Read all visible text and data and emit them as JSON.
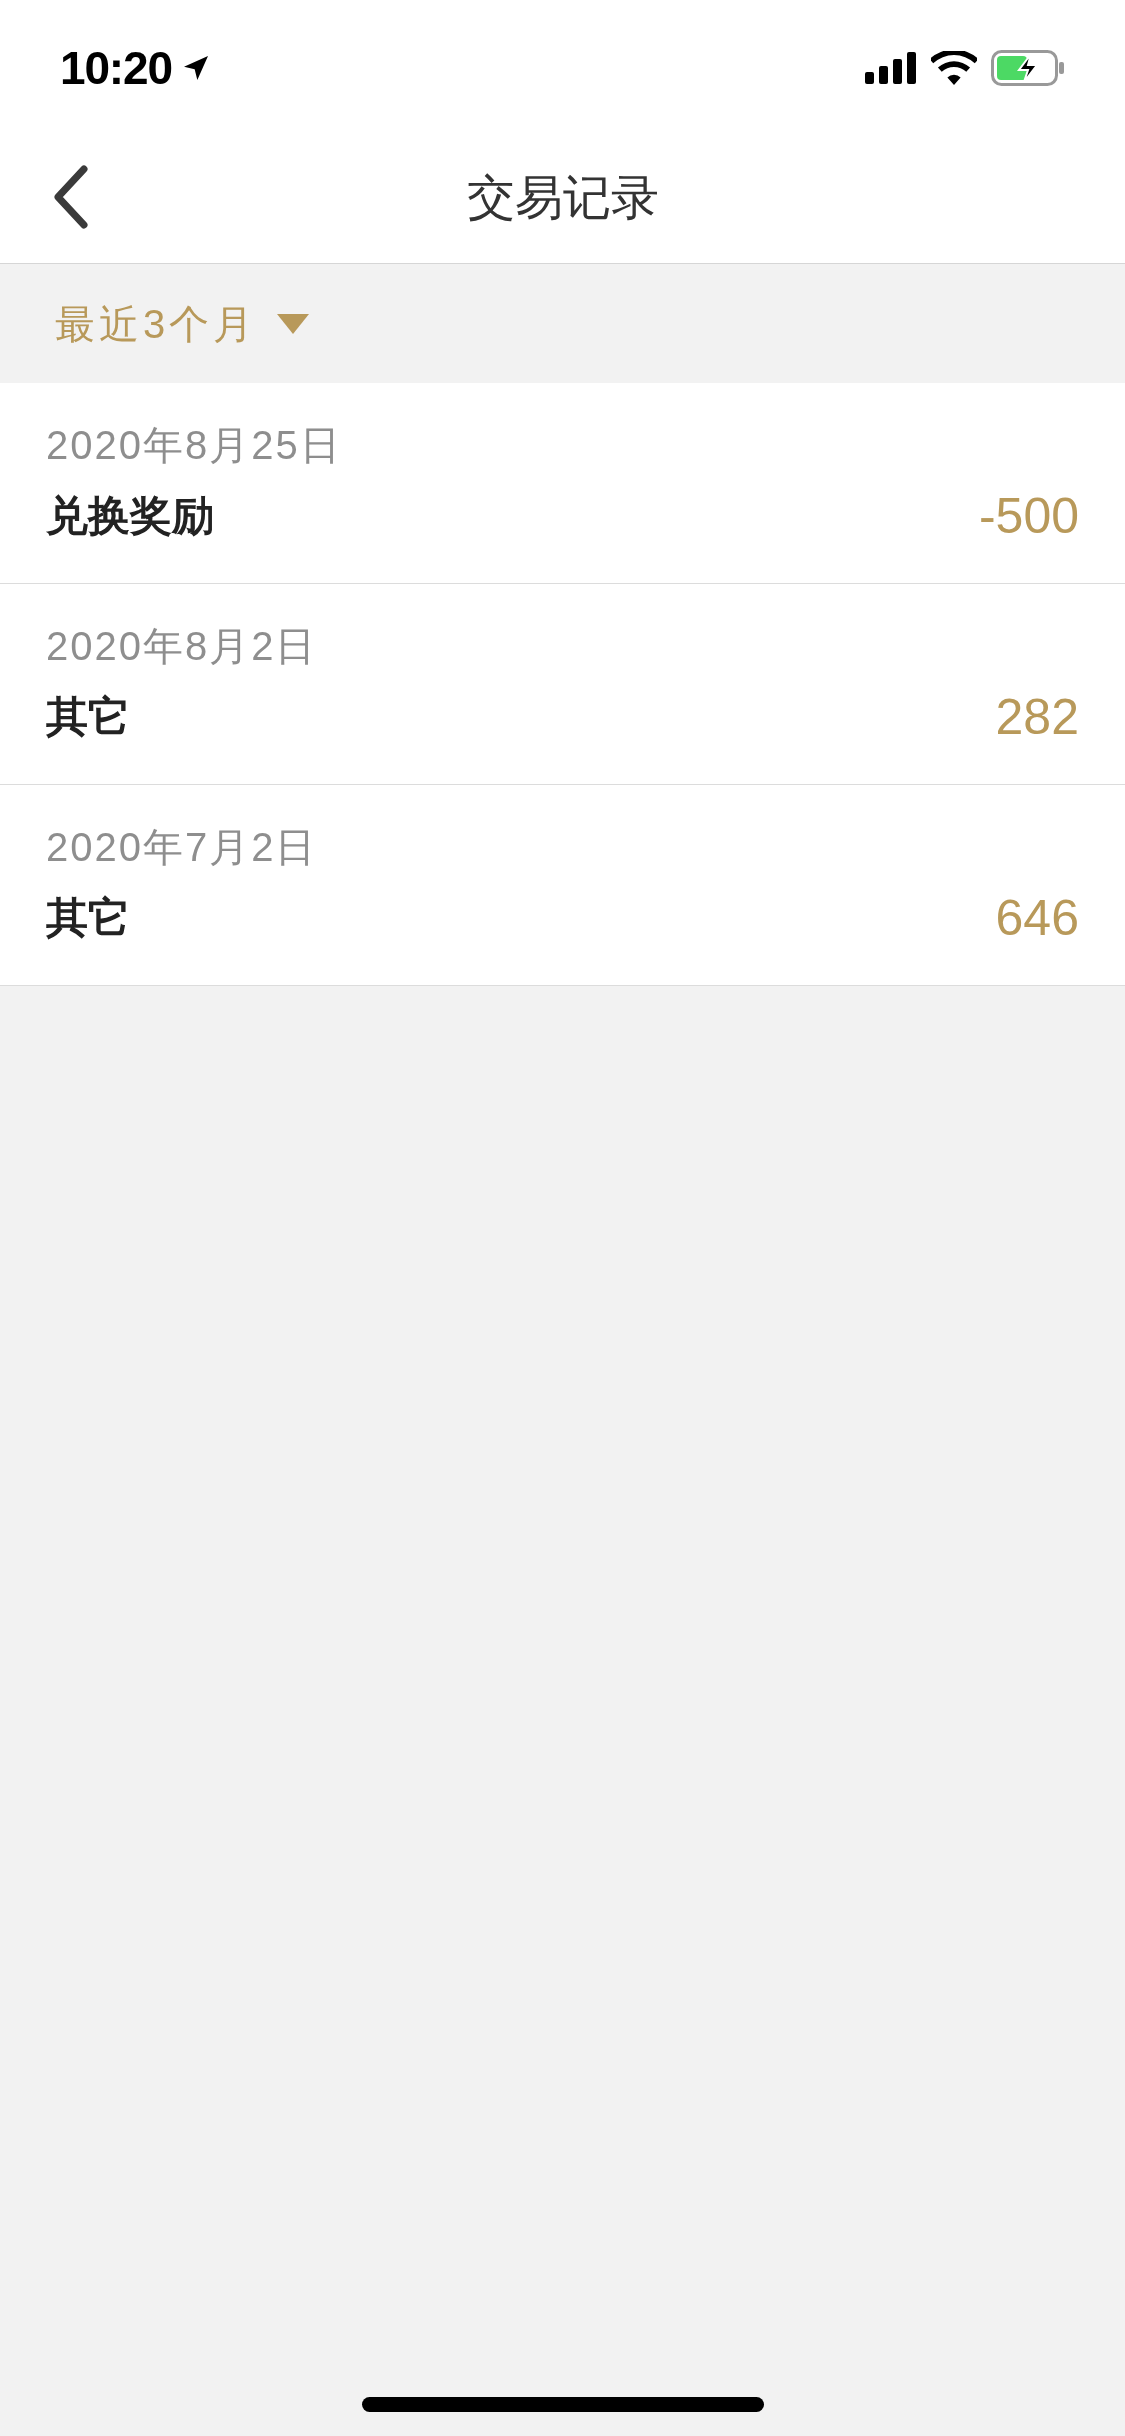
{
  "status_bar": {
    "time": "10:20"
  },
  "nav": {
    "title": "交易记录"
  },
  "filter": {
    "label": "最近3个月"
  },
  "records": [
    {
      "date": "2020年8月25日",
      "label": "兑换奖励",
      "amount": "-500"
    },
    {
      "date": "2020年8月2日",
      "label": "其它",
      "amount": "282"
    },
    {
      "date": "2020年7月2日",
      "label": "其它",
      "amount": "646"
    }
  ]
}
